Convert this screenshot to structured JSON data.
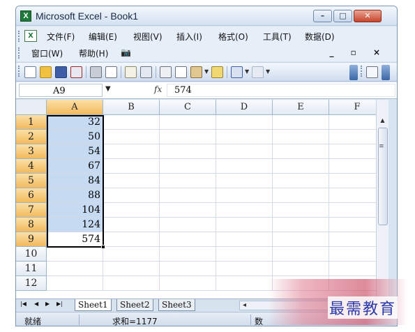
{
  "window": {
    "title": "Microsoft Excel - Book1"
  },
  "menu": {
    "row1": [
      "文件(F)",
      "编辑(E)",
      "视图(V)",
      "插入(I)",
      "格式(O)",
      "工具(T)",
      "数据(D)"
    ],
    "row2": [
      "窗口(W)",
      "帮助(H)"
    ]
  },
  "formula_bar": {
    "name_box": "A9",
    "fx": "fx",
    "value": "574"
  },
  "columns": [
    "A",
    "B",
    "C",
    "D",
    "E",
    "F"
  ],
  "rows": [
    "1",
    "2",
    "3",
    "4",
    "5",
    "6",
    "7",
    "8",
    "9",
    "10",
    "11",
    "12"
  ],
  "column_a_values": [
    "32",
    "50",
    "54",
    "67",
    "84",
    "88",
    "104",
    "124",
    "574"
  ],
  "sheets": [
    "Sheet1",
    "Sheet2",
    "Sheet3"
  ],
  "status": {
    "ready": "就绪",
    "sum": "求和=1177",
    "num": "数"
  },
  "watermark": "最需教育",
  "colors": {
    "selection": "#c6daf2",
    "header_active": "#f2b95d",
    "excel_green": "#1d7a3a"
  }
}
